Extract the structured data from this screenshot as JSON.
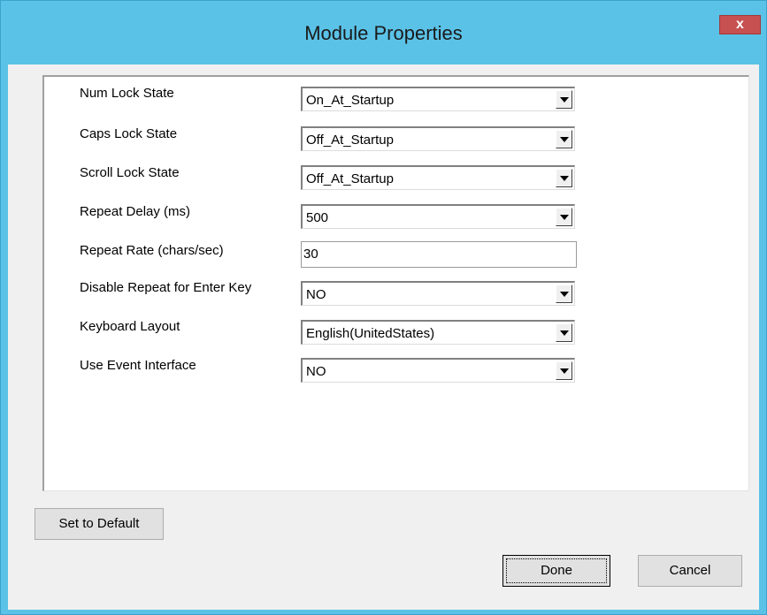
{
  "window": {
    "title": "Module Properties",
    "close_glyph": "x"
  },
  "fields": [
    {
      "label": "Num Lock State",
      "type": "combo",
      "value": "On_At_Startup"
    },
    {
      "label": "Caps Lock State",
      "type": "combo",
      "value": "Off_At_Startup"
    },
    {
      "label": "Scroll Lock State",
      "type": "combo",
      "value": "Off_At_Startup"
    },
    {
      "label": "Repeat Delay (ms)",
      "type": "combo",
      "value": "500"
    },
    {
      "label": "Repeat Rate (chars/sec)",
      "type": "text",
      "value": "30"
    },
    {
      "label": "Disable Repeat for Enter Key",
      "type": "combo",
      "value": "NO"
    },
    {
      "label": "Keyboard Layout",
      "type": "combo",
      "value": "English(UnitedStates)"
    },
    {
      "label": "Use Event Interface",
      "type": "combo",
      "value": "NO"
    }
  ],
  "buttons": {
    "set_default": "Set to Default",
    "done": "Done",
    "cancel": "Cancel"
  },
  "icons": {
    "dropdown": "chevron-down-icon",
    "close": "close-icon"
  },
  "colors": {
    "titlebar": "#5bc2e7",
    "close": "#c75050",
    "dialog": "#f0f0f0"
  }
}
